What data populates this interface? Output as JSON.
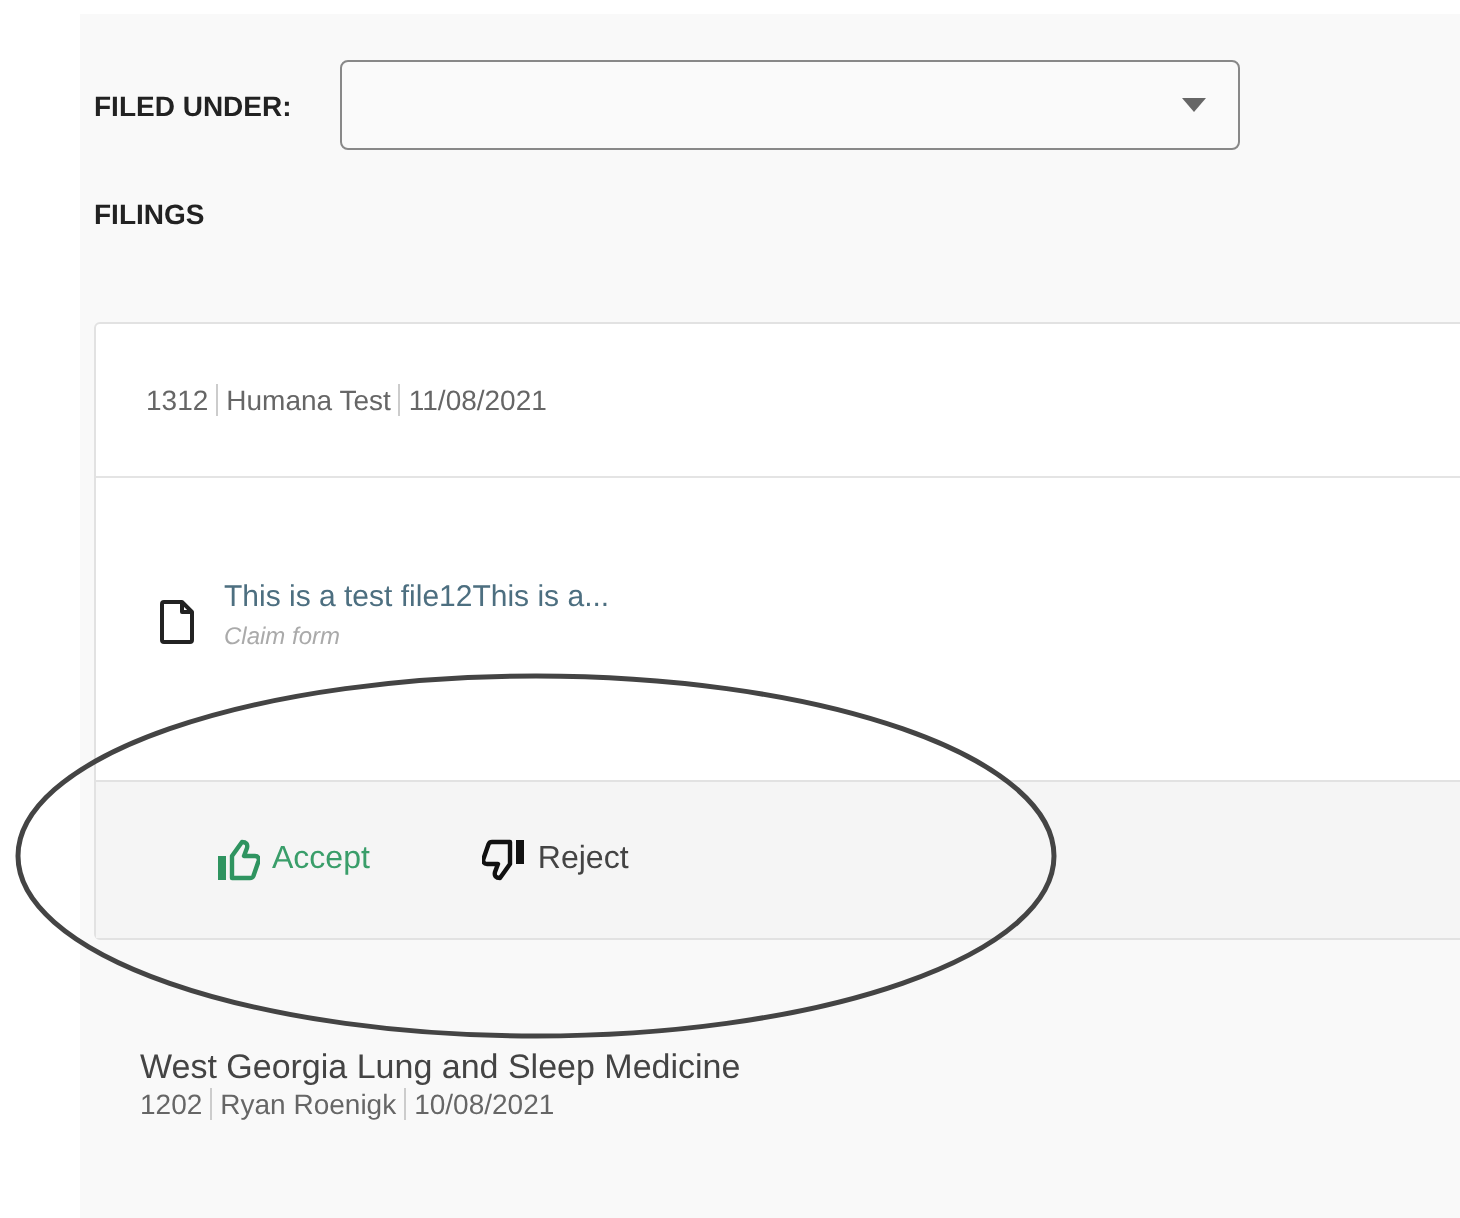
{
  "filter": {
    "label": "FILED UNDER:"
  },
  "filings_heading": "FILINGS",
  "filings": [
    {
      "expanded": true,
      "meta": [
        "1312",
        "Humana Test",
        "11/08/2021"
      ],
      "document": {
        "name": "This is a test file12This is a...",
        "type": "Claim form"
      },
      "actions": [
        {
          "kind": "accept",
          "label": "Accept"
        },
        {
          "kind": "reject",
          "label": "Reject"
        }
      ]
    },
    {
      "expanded": false,
      "title": "West Georgia Lung and Sleep Medicine",
      "meta": [
        "1202",
        "Ryan Roenigk",
        "10/08/2021"
      ]
    }
  ]
}
